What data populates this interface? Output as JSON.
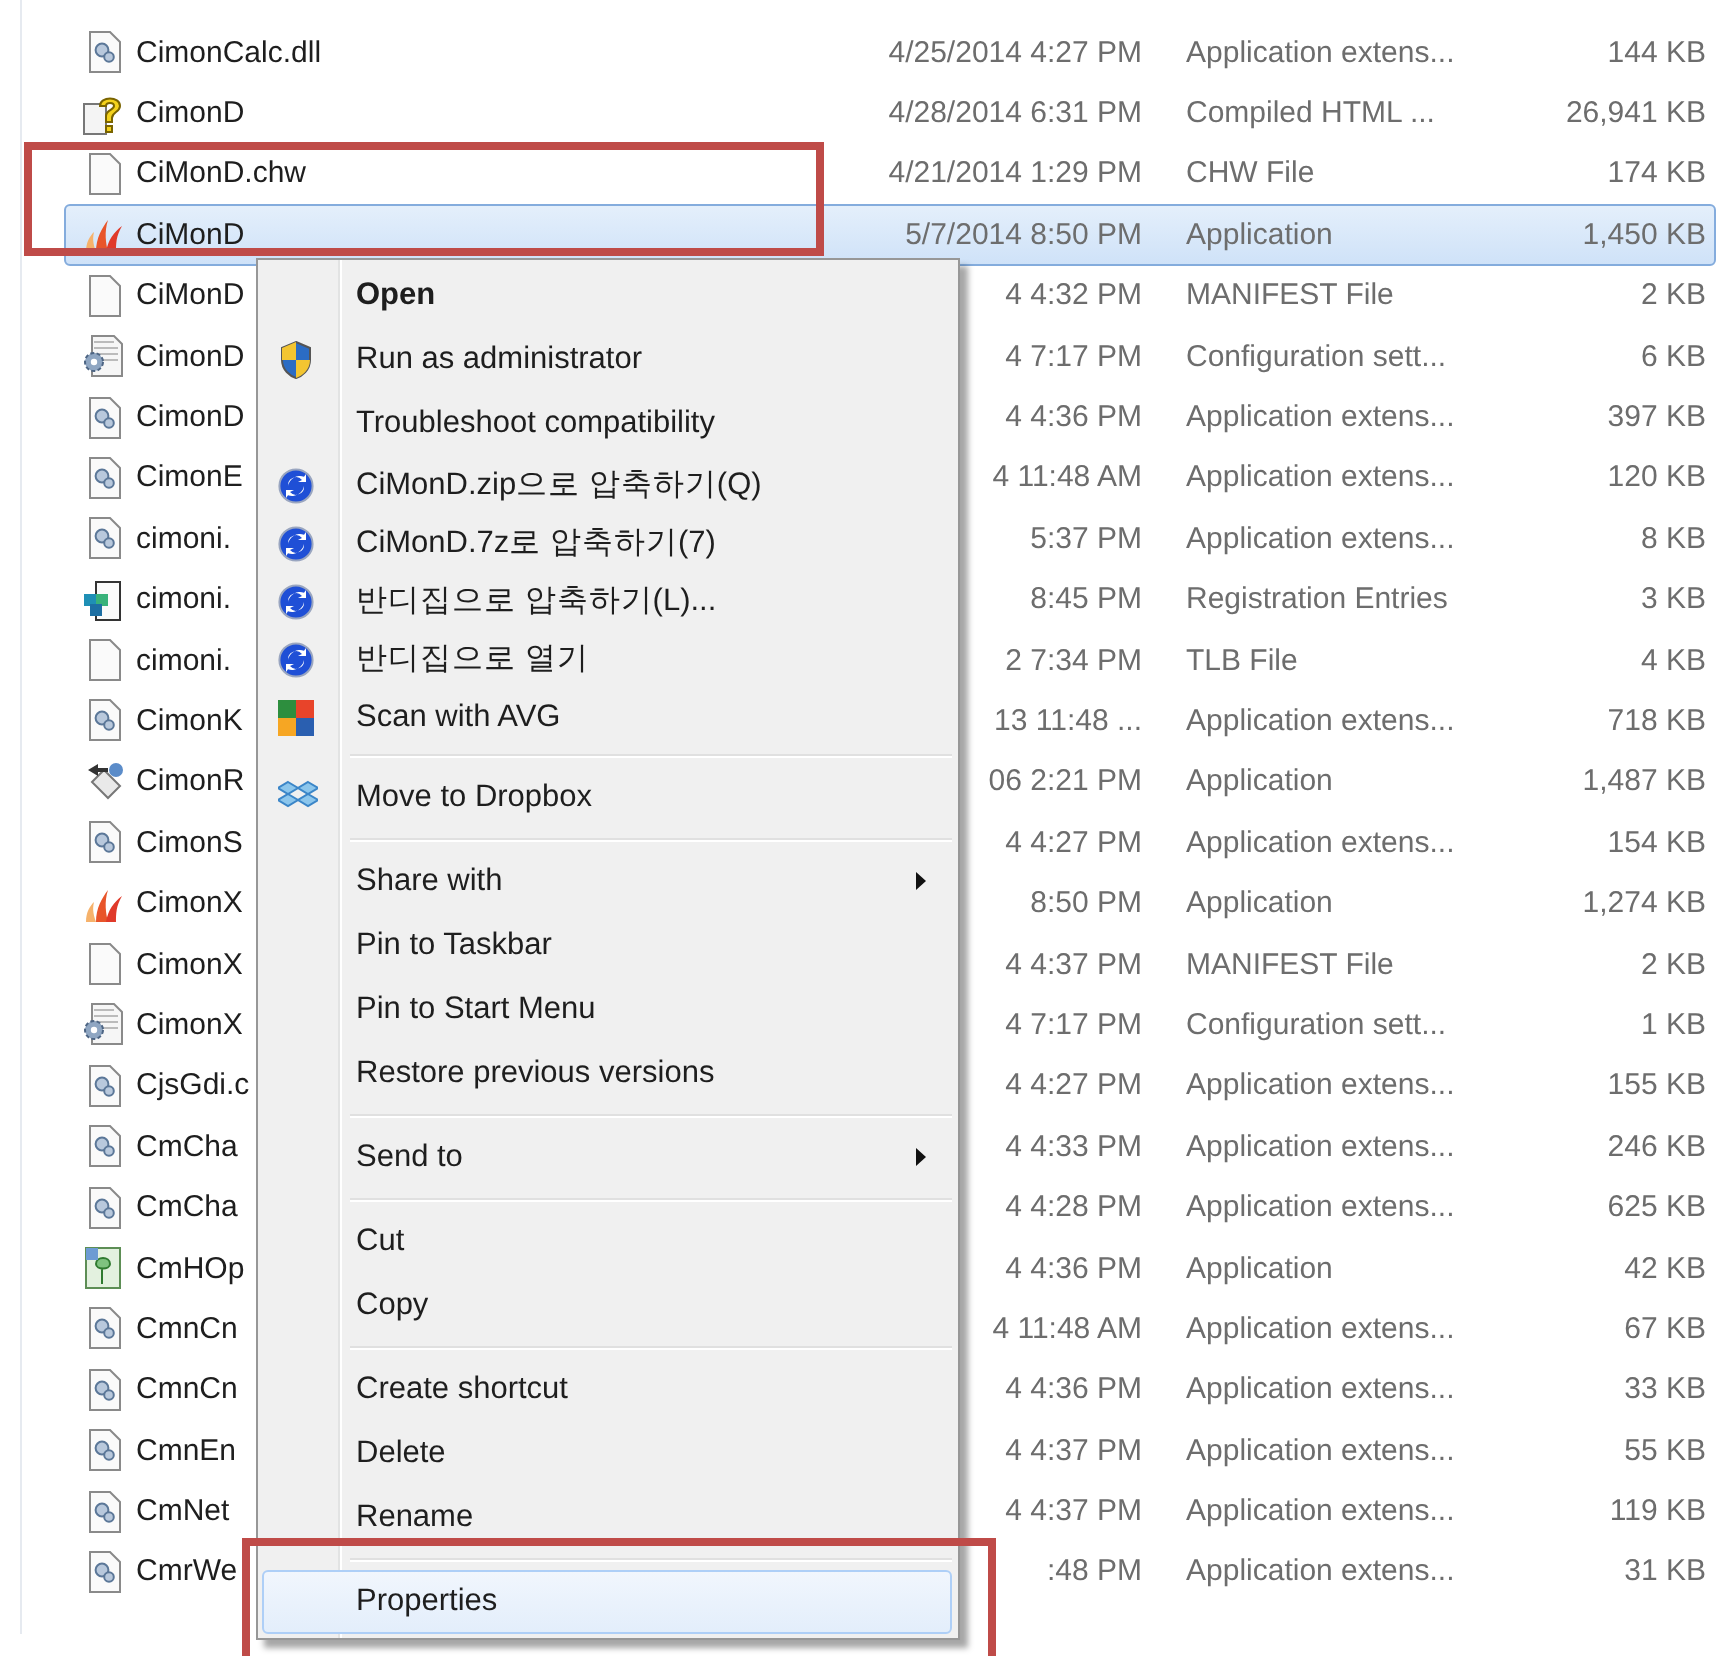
{
  "file_list": {
    "rows": [
      {
        "name": "CimonCalc.dll",
        "date": "4/25/2014 4:27 PM",
        "type": "Application extens...",
        "size": "144 KB",
        "selected": false
      },
      {
        "name": "CimonD",
        "date": "4/28/2014 6:31 PM",
        "type": "Compiled HTML ...",
        "size": "26,941 KB",
        "selected": false
      },
      {
        "name": "CiMonD.chw",
        "date": "4/21/2014 1:29 PM",
        "type": "CHW File",
        "size": "174 KB",
        "selected": false
      },
      {
        "name": "CiMonD",
        "date": "5/7/2014 8:50 PM",
        "type": "Application",
        "size": "1,450 KB",
        "selected": true
      },
      {
        "name": "CiMonD",
        "date": "4 4:32 PM",
        "type": "MANIFEST File",
        "size": "2 KB",
        "selected": false
      },
      {
        "name": "CimonD",
        "date": "4 7:17 PM",
        "type": "Configuration sett...",
        "size": "6 KB",
        "selected": false
      },
      {
        "name": "CimonD",
        "date": "4 4:36 PM",
        "type": "Application extens...",
        "size": "397 KB",
        "selected": false
      },
      {
        "name": "CimonE",
        "date": "4 11:48 AM",
        "type": "Application extens...",
        "size": "120 KB",
        "selected": false
      },
      {
        "name": "cimoni.",
        "date": "5:37 PM",
        "type": "Application extens...",
        "size": "8 KB",
        "selected": false
      },
      {
        "name": "cimoni.",
        "date": "8:45 PM",
        "type": "Registration Entries",
        "size": "3 KB",
        "selected": false
      },
      {
        "name": "cimoni.",
        "date": "2 7:34 PM",
        "type": "TLB File",
        "size": "4 KB",
        "selected": false
      },
      {
        "name": "CimonK",
        "date": "13 11:48 ...",
        "type": "Application extens...",
        "size": "718 KB",
        "selected": false
      },
      {
        "name": "CimonR",
        "date": "06 2:21 PM",
        "type": "Application",
        "size": "1,487 KB",
        "selected": false
      },
      {
        "name": "CimonS",
        "date": "4 4:27 PM",
        "type": "Application extens...",
        "size": "154 KB",
        "selected": false
      },
      {
        "name": "CimonX",
        "date": "8:50 PM",
        "type": "Application",
        "size": "1,274 KB",
        "selected": false
      },
      {
        "name": "CimonX",
        "date": "4 4:37 PM",
        "type": "MANIFEST File",
        "size": "2 KB",
        "selected": false
      },
      {
        "name": "CimonX",
        "date": "4 7:17 PM",
        "type": "Configuration sett...",
        "size": "1 KB",
        "selected": false
      },
      {
        "name": "CjsGdi.c",
        "date": "4 4:27 PM",
        "type": "Application extens...",
        "size": "155 KB",
        "selected": false
      },
      {
        "name": "CmCha",
        "date": "4 4:33 PM",
        "type": "Application extens...",
        "size": "246 KB",
        "selected": false
      },
      {
        "name": "CmCha",
        "date": "4 4:28 PM",
        "type": "Application extens...",
        "size": "625 KB",
        "selected": false
      },
      {
        "name": "CmHOp",
        "date": "4 4:36 PM",
        "type": "Application",
        "size": "42 KB",
        "selected": false
      },
      {
        "name": "CmnCn",
        "date": "4 11:48 AM",
        "type": "Application extens...",
        "size": "67 KB",
        "selected": false
      },
      {
        "name": "CmnCn",
        "date": "4 4:36 PM",
        "type": "Application extens...",
        "size": "33 KB",
        "selected": false
      },
      {
        "name": "CmnEn",
        "date": "4 4:37 PM",
        "type": "Application extens...",
        "size": "55 KB",
        "selected": false
      },
      {
        "name": "CmNet",
        "date": "4 4:37 PM",
        "type": "Application extens...",
        "size": "119 KB",
        "selected": false
      },
      {
        "name": "CmrWe",
        "date": ":48 PM",
        "type": "Application extens...",
        "size": "31 KB",
        "selected": false
      }
    ]
  },
  "context_menu": {
    "items": [
      {
        "kind": "item",
        "label": "Open",
        "default": true,
        "submenu": false,
        "selected": false
      },
      {
        "kind": "item",
        "label": "Run as administrator",
        "default": false,
        "submenu": false,
        "selected": false
      },
      {
        "kind": "item",
        "label": "Troubleshoot compatibility",
        "default": false,
        "submenu": false,
        "selected": false
      },
      {
        "kind": "item",
        "label": "CiMonD.zip으로 압축하기(Q)",
        "default": false,
        "submenu": false,
        "selected": false
      },
      {
        "kind": "item",
        "label": "CiMonD.7z로 압축하기(7)",
        "default": false,
        "submenu": false,
        "selected": false
      },
      {
        "kind": "item",
        "label": "반디집으로 압축하기(L)...",
        "default": false,
        "submenu": false,
        "selected": false
      },
      {
        "kind": "item",
        "label": "반디집으로 열기",
        "default": false,
        "submenu": false,
        "selected": false
      },
      {
        "kind": "item",
        "label": "Scan with AVG",
        "default": false,
        "submenu": false,
        "selected": false
      },
      {
        "kind": "separator"
      },
      {
        "kind": "item",
        "label": "Move to Dropbox",
        "default": false,
        "submenu": false,
        "selected": false
      },
      {
        "kind": "separator"
      },
      {
        "kind": "item",
        "label": "Share with",
        "default": false,
        "submenu": true,
        "selected": false
      },
      {
        "kind": "item",
        "label": "Pin to Taskbar",
        "default": false,
        "submenu": false,
        "selected": false
      },
      {
        "kind": "item",
        "label": "Pin to Start Menu",
        "default": false,
        "submenu": false,
        "selected": false
      },
      {
        "kind": "item",
        "label": "Restore previous versions",
        "default": false,
        "submenu": false,
        "selected": false
      },
      {
        "kind": "separator"
      },
      {
        "kind": "item",
        "label": "Send to",
        "default": false,
        "submenu": true,
        "selected": false
      },
      {
        "kind": "separator"
      },
      {
        "kind": "item",
        "label": "Cut",
        "default": false,
        "submenu": false,
        "selected": false
      },
      {
        "kind": "item",
        "label": "Copy",
        "default": false,
        "submenu": false,
        "selected": false
      },
      {
        "kind": "separator"
      },
      {
        "kind": "item",
        "label": "Create shortcut",
        "default": false,
        "submenu": false,
        "selected": false
      },
      {
        "kind": "item",
        "label": "Delete",
        "default": false,
        "submenu": false,
        "selected": false
      },
      {
        "kind": "item",
        "label": "Rename",
        "default": false,
        "submenu": false,
        "selected": false
      },
      {
        "kind": "separator"
      },
      {
        "kind": "item",
        "label": "Properties",
        "default": false,
        "submenu": false,
        "selected": true
      }
    ]
  }
}
